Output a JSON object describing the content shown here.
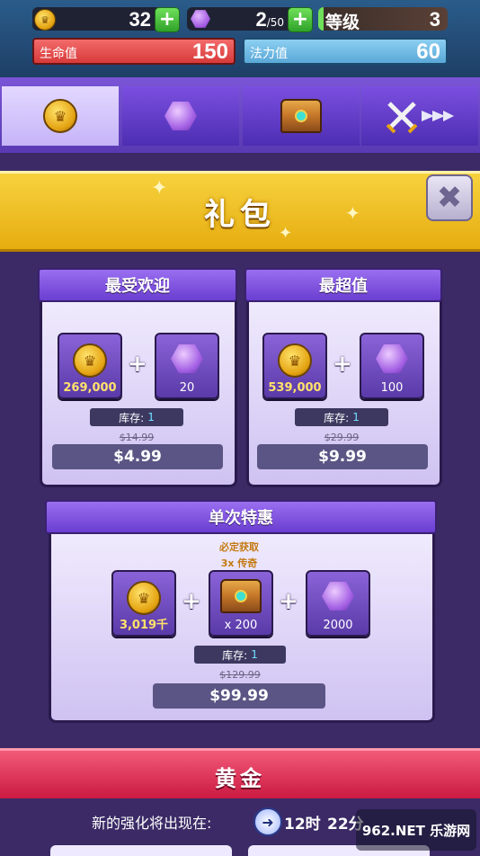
{
  "topbar": {
    "coins": "32",
    "gems": "2",
    "gems_max": "/50",
    "level_label": "等级",
    "level": "3",
    "hp_label": "生命值",
    "hp": "150",
    "mana_label": "法力值",
    "mana": "60"
  },
  "banner": {
    "title": "礼包"
  },
  "packs": [
    {
      "title": "最受欢迎",
      "coins": "269,000",
      "gems": "20",
      "stock_label": "库存:",
      "stock": "1",
      "old_price": "$14.99",
      "price": "$4.99"
    },
    {
      "title": "最超值",
      "coins": "539,000",
      "gems": "100",
      "stock_label": "库存:",
      "stock": "1",
      "old_price": "$29.99",
      "price": "$9.99"
    }
  ],
  "special": {
    "title": "单次特惠",
    "guarantee": "必定获取",
    "legendary": "3x 传奇",
    "coins": "3,019千",
    "chests": "x 200",
    "gems": "2000",
    "stock_label": "库存:",
    "stock": "1",
    "old_price": "$129.99",
    "price": "$99.99"
  },
  "gold": {
    "title": "黄金",
    "refresh_label": "新的强化将出现在:",
    "hours": "12时",
    "minutes": "22分"
  },
  "watermark": "962.NET 乐游网",
  "colors": {
    "accent_purple": "#6a3ed0",
    "gold": "#e6ad10",
    "red": "#c9163f",
    "hp_bar": "#e84a4a",
    "mana_bar": "#6ab6e6"
  }
}
